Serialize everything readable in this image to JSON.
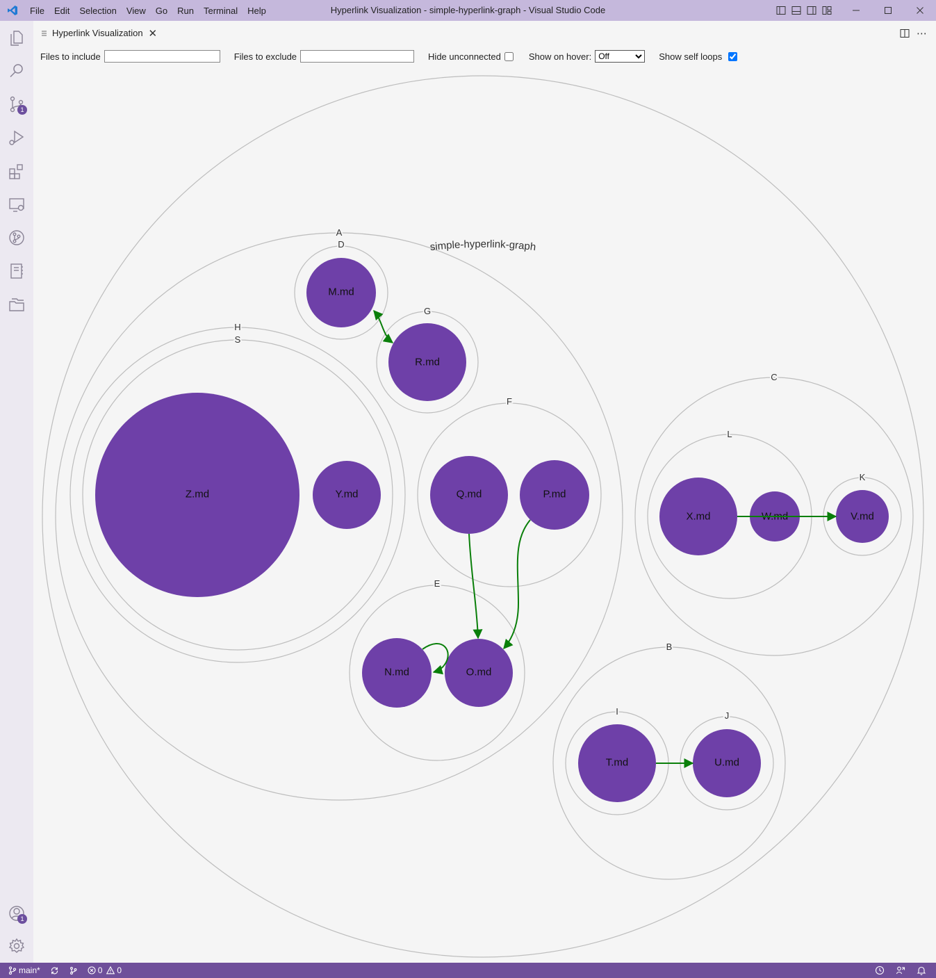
{
  "titlebar": {
    "title": "Hyperlink Visualization - simple-hyperlink-graph - Visual Studio Code",
    "menu": [
      "File",
      "Edit",
      "Selection",
      "View",
      "Go",
      "Run",
      "Terminal",
      "Help"
    ]
  },
  "activity": {
    "scm_badge": "1",
    "accounts_badge": "1"
  },
  "tab": {
    "label": "Hyperlink Visualization"
  },
  "toolbar": {
    "include_label": "Files to include",
    "include_value": "",
    "exclude_label": "Files to exclude",
    "exclude_value": "",
    "hide_unconnected_label": "Hide unconnected",
    "hide_unconnected_checked": false,
    "hover_label": "Show on hover:",
    "hover_value": "Off",
    "self_loops_label": "Show self loops",
    "self_loops_checked": true
  },
  "graph": {
    "root": "simple-hyperlink-graph",
    "groups": {
      "A": "A",
      "D": "D",
      "G": "G",
      "H": "H",
      "S": "S",
      "F": "F",
      "E": "E",
      "C": "C",
      "L": "L",
      "K": "K",
      "B": "B",
      "I": "I",
      "J": "J"
    },
    "files": {
      "M": "M.md",
      "R": "R.md",
      "Z": "Z.md",
      "Y": "Y.md",
      "Q": "Q.md",
      "P": "P.md",
      "N": "N.md",
      "O": "O.md",
      "X": "X.md",
      "W": "W.md",
      "V": "V.md",
      "T": "T.md",
      "U": "U.md"
    },
    "links": [
      [
        "M.md",
        "R.md"
      ],
      [
        "R.md",
        "M.md"
      ],
      [
        "Q.md",
        "O.md"
      ],
      [
        "P.md",
        "O.md"
      ],
      [
        "O.md",
        "N.md"
      ],
      [
        "X.md",
        "V.md"
      ],
      [
        "T.md",
        "U.md"
      ]
    ],
    "colors": {
      "file_fill": "#6e40a8",
      "link": "#0a7f0a",
      "group_stroke": "#bdbdbd"
    }
  },
  "statusbar": {
    "branch": "main*",
    "errors": "0",
    "warnings": "0"
  }
}
